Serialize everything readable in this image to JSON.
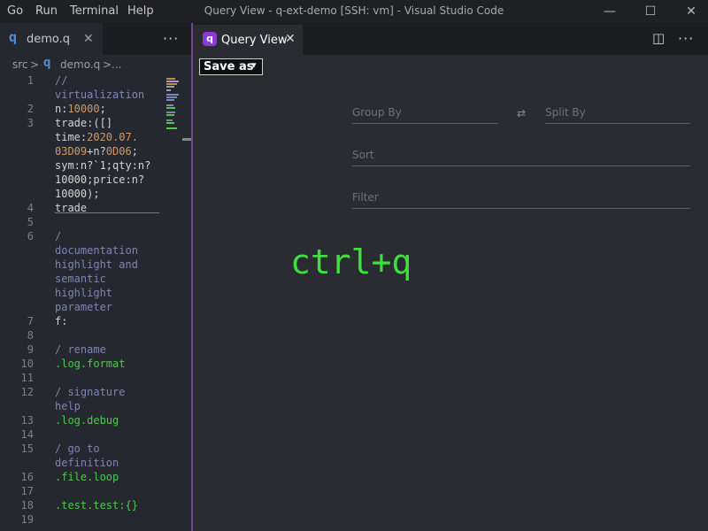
{
  "menu": [
    "Go",
    "Run",
    "Terminal",
    "Help"
  ],
  "window_title": "Query View - q-ext-demo [SSH: vm] - Visual Studio Code",
  "window_controls": {
    "minimize": "—",
    "maximize": "☐",
    "close": "✕"
  },
  "left_editor": {
    "tab": {
      "icon": "q",
      "name": "demo.q",
      "close": "✕"
    },
    "more": "···",
    "breadcrumb": {
      "folder": "src",
      "sep": ">",
      "icon": "q",
      "file": "demo.q",
      "sep2": ">",
      "trail": "..."
    }
  },
  "code_lines": [
    {
      "n": "1",
      "text": "//"
    },
    {
      "n": "",
      "text": "virtualization"
    },
    {
      "n": "2",
      "pre": "n:",
      "num": "10000",
      "post": ";"
    },
    {
      "n": "3",
      "text": "trade:([]"
    },
    {
      "n": "",
      "pre": "time:",
      "num": "2020.07.",
      "post": ""
    },
    {
      "n": "",
      "num": "03D09",
      "pre2": "+n?",
      "num2": "0D06",
      "post": ";"
    },
    {
      "n": "",
      "text": "sym:n?`1;qty:n?"
    },
    {
      "n": "",
      "text": "10000;price:n?"
    },
    {
      "n": "",
      "text": "10000);"
    },
    {
      "n": "4",
      "text": "trade"
    },
    {
      "n": "5",
      "text": ""
    },
    {
      "n": "6",
      "text": "/"
    },
    {
      "n": "",
      "text": "documentation"
    },
    {
      "n": "",
      "text": "highlight and"
    },
    {
      "n": "",
      "text": "semantic"
    },
    {
      "n": "",
      "text": "highlight"
    },
    {
      "n": "",
      "text": "parameter"
    },
    {
      "n": "7",
      "text": "f:"
    },
    {
      "n": "8",
      "text": ""
    },
    {
      "n": "9",
      "text": "/ rename"
    },
    {
      "n": "10",
      "text": ".log.format"
    },
    {
      "n": "11",
      "text": ""
    },
    {
      "n": "12",
      "text": "/ signature"
    },
    {
      "n": "",
      "text": "help"
    },
    {
      "n": "13",
      "text": ".log.debug"
    },
    {
      "n": "14",
      "text": ""
    },
    {
      "n": "15",
      "text": "/ go to"
    },
    {
      "n": "",
      "text": "definition"
    },
    {
      "n": "16",
      "text": ".file.loop"
    },
    {
      "n": "17",
      "text": ""
    },
    {
      "n": "18",
      "text": ".test.test:{}"
    },
    {
      "n": "19",
      "text": ""
    }
  ],
  "right_editor": {
    "tab": {
      "icon": "q",
      "name": "Query View",
      "close": "✕"
    },
    "split_icon": "◫",
    "more": "···"
  },
  "query_view": {
    "save_as_label": "Save as",
    "save_as_arrow": "▾",
    "group_by_placeholder": "Group By",
    "swap_icon": "⇄",
    "split_by_placeholder": "Split By",
    "sort_placeholder": "Sort",
    "filter_placeholder": "Filter"
  },
  "overlay_text": "ctrl+q",
  "colors": {
    "accent_purple": "#8a3ad6",
    "q_blue": "#4a90d9",
    "overlay_green": "#3ee03e"
  }
}
